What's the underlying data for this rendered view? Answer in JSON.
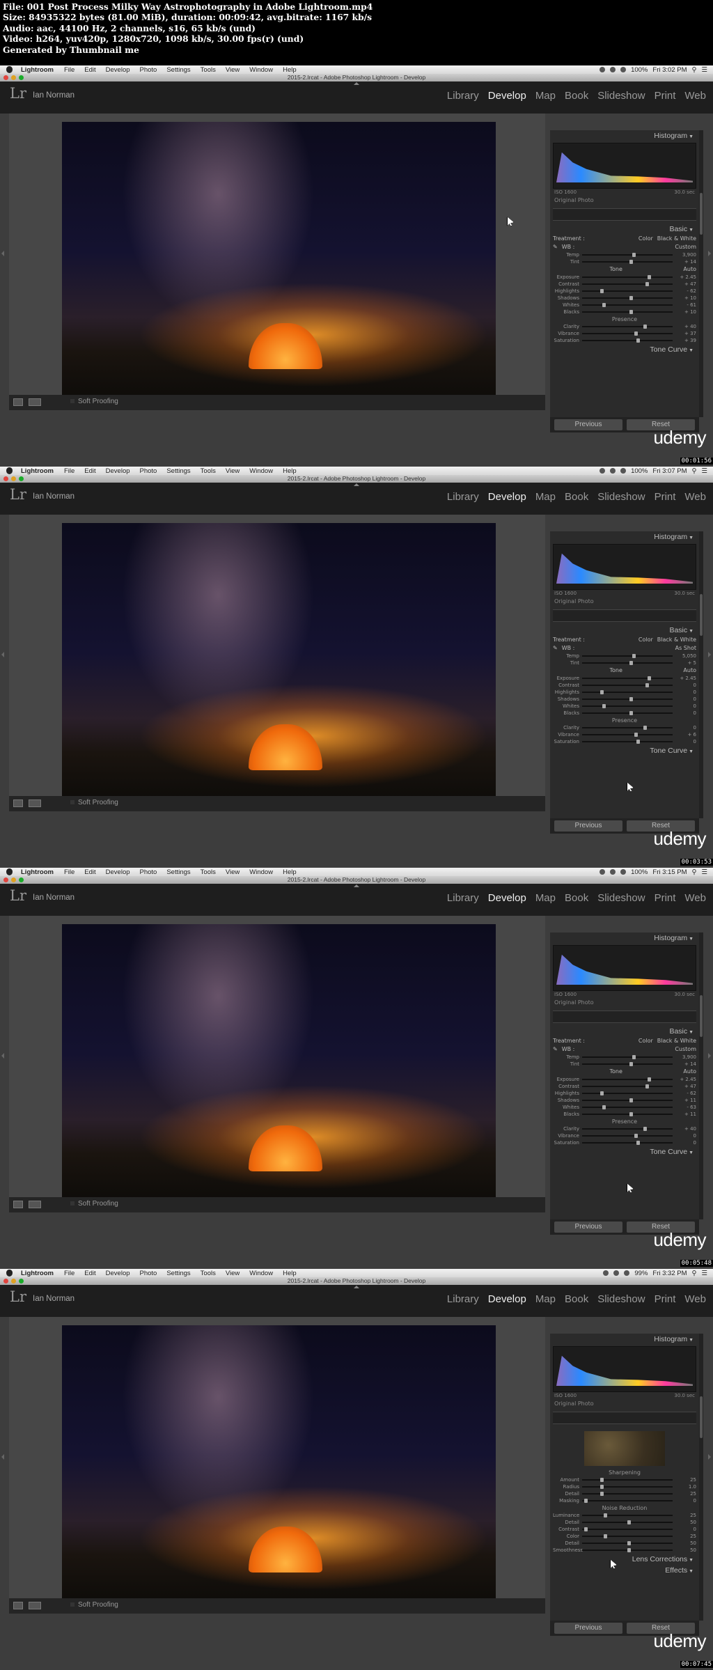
{
  "header": {
    "lines": [
      "File: 001 Post Process Milky Way Astrophotography in Adobe Lightroom.mp4",
      "Size: 84935322 bytes (81.00 MiB), duration: 00:09:42, avg.bitrate: 1167 kb/s",
      "Audio: aac, 44100 Hz, 2 channels, s16, 65 kb/s (und)",
      "Video: h264, yuv420p, 1280x720, 1098 kb/s, 30.00 fps(r) (und)",
      "Generated by Thumbnail me"
    ]
  },
  "menubar": {
    "app": "Lightroom",
    "items": [
      "File",
      "Edit",
      "Develop",
      "Photo",
      "Settings",
      "Tools",
      "View",
      "Window",
      "Help"
    ],
    "battery": [
      "100%",
      "100%",
      "100%",
      "99%"
    ],
    "clock": [
      "Fri 3:02 PM",
      "Fri 3:07 PM",
      "Fri 3:15 PM",
      "Fri 3:32 PM"
    ]
  },
  "window": {
    "title": "2015-2.lrcat - Adobe Photoshop Lightroom - Develop"
  },
  "identity": {
    "logo": "Lr",
    "user": "Ian Norman"
  },
  "modules": [
    "Library",
    "Develop",
    "Map",
    "Book",
    "Slideshow",
    "Print",
    "Web"
  ],
  "active_module": "Develop",
  "toolbar": {
    "soft_proofing": "Soft Proofing"
  },
  "buttons": {
    "previous": "Previous",
    "reset": "Reset"
  },
  "watermark": "udemy",
  "timestamps": [
    "00:01:56",
    "00:03:53",
    "00:05:48",
    "00:07:45"
  ],
  "panels": {
    "histogram": "Histogram",
    "iso": "ISO 1600",
    "shutter": "30.0 sec",
    "original_photo": "Original Photo",
    "basic": "Basic",
    "treatment": "Treatment :",
    "color": "Color",
    "bw": "Black & White",
    "wb": "WB :",
    "wb_values": [
      "Custom",
      "As Shot",
      "Custom"
    ],
    "temp": "Temp",
    "tint": "Tint",
    "tone": "Tone",
    "auto": "Auto",
    "exposure": "Exposure",
    "contrast": "Contrast",
    "highlights": "Highlights",
    "shadows": "Shadows",
    "whites": "Whites",
    "blacks": "Blacks",
    "presence": "Presence",
    "clarity": "Clarity",
    "vibrance": "Vibrance",
    "saturation": "Saturation",
    "tone_curve": "Tone Curve",
    "sharpening": "Sharpening",
    "amount": "Amount",
    "radius": "Radius",
    "detail": "Detail",
    "masking": "Masking",
    "noise_reduction": "Noise Reduction",
    "luminance": "Luminance",
    "color_nr": "Color",
    "smoothness": "Smoothness",
    "lens_corrections": "Lens Corrections",
    "effects": "Effects"
  },
  "frame1_values": {
    "temp": "3,900",
    "tint": "+ 14",
    "exposure": "+ 2.45",
    "contrast": "+ 47",
    "highlights": "- 62",
    "shadows": "+ 10",
    "whites": "- 61",
    "blacks": "+ 10",
    "clarity": "+ 40",
    "vibrance": "+ 37",
    "saturation": "+ 39"
  },
  "frame2_values": {
    "temp": "5,050",
    "tint": "+ 5",
    "exposure": "+ 2.45",
    "contrast": "0",
    "highlights": "0",
    "shadows": "0",
    "whites": "0",
    "blacks": "0",
    "clarity": "0",
    "vibrance": "+ 6",
    "saturation": "0"
  },
  "frame3_values": {
    "temp": "3,900",
    "tint": "+ 14",
    "exposure": "+ 2.45",
    "contrast": "+ 47",
    "highlights": "- 62",
    "shadows": "+ 11",
    "whites": "- 63",
    "blacks": "+ 11",
    "clarity": "+ 40",
    "vibrance": "0",
    "saturation": "0"
  },
  "frame4_values": {
    "amount": "25",
    "radius": "1.0",
    "detail": "25",
    "masking": "0",
    "luminance": "25",
    "lum_detail": "50",
    "lum_contrast": "0",
    "color": "25",
    "col_detail": "50",
    "smoothness": "50"
  }
}
